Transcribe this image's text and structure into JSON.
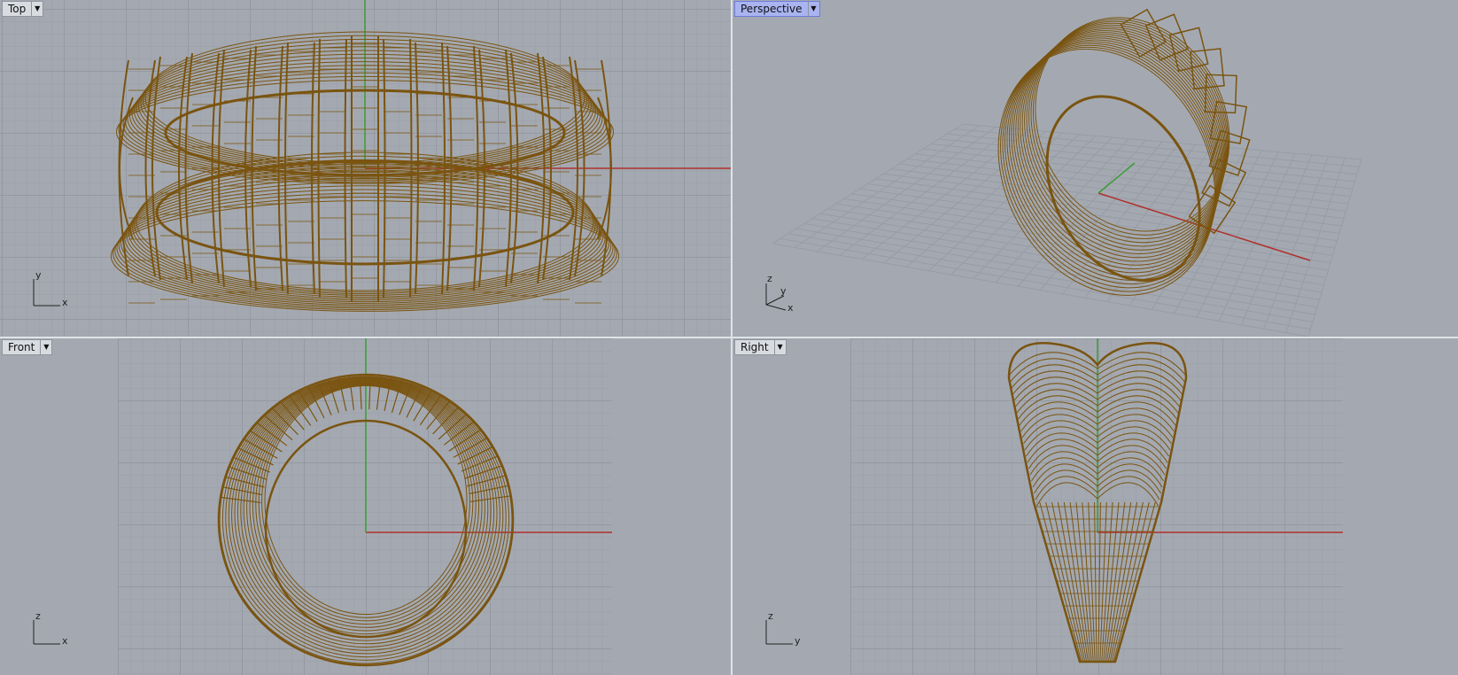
{
  "viewports": {
    "top": {
      "label": "Top",
      "active": false,
      "axes": {
        "h": "x",
        "v": "y"
      }
    },
    "perspective": {
      "label": "Perspective",
      "active": true,
      "axes": {
        "v": "z",
        "d": "y",
        "h": "x"
      }
    },
    "front": {
      "label": "Front",
      "active": false,
      "axes": {
        "h": "x",
        "v": "z"
      }
    },
    "right": {
      "label": "Right",
      "active": false,
      "axes": {
        "h": "y",
        "v": "z"
      }
    }
  },
  "icons": {
    "dropdown": "caret-down-icon"
  },
  "colors": {
    "viewport_bg": "#a4a9b1",
    "grid_minor": "#989da6",
    "grid_major": "#868b94",
    "x_axis": "#b0302c",
    "y_axis": "#3a9c35",
    "wireframe": "#7a5410",
    "active_tab": "#a9b4f0"
  }
}
